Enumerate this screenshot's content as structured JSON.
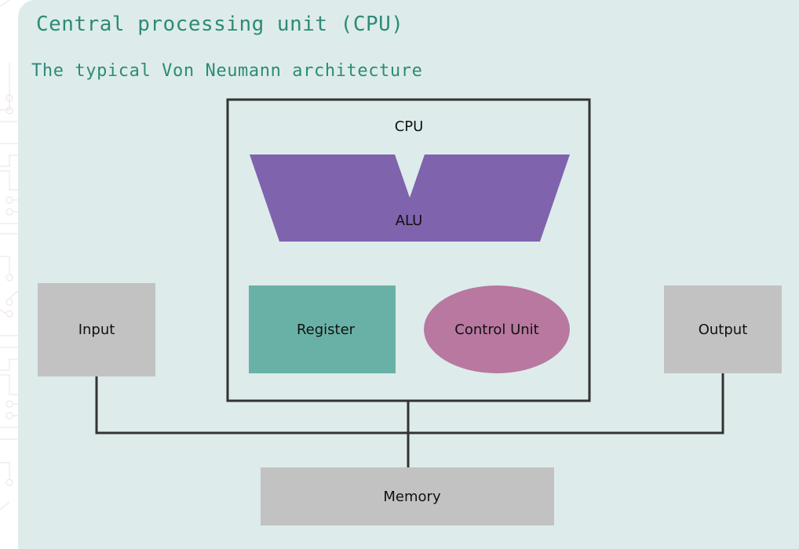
{
  "header": {
    "title": "Central processing unit (CPU)",
    "subtitle": "The typical Von Neumann architecture"
  },
  "diagram": {
    "cpu_label": "CPU",
    "alu_label": "ALU",
    "register_label": "Register",
    "control_unit_label": "Control Unit",
    "input_label": "Input",
    "output_label": "Output",
    "memory_label": "Memory"
  },
  "colors": {
    "background": "#ddecea",
    "title": "#2e8a78",
    "alu": "#7f63ad",
    "register": "#69b1a6",
    "control_unit": "#b878a0",
    "io_memory": "#c2c2c2",
    "lines": "#333333"
  }
}
